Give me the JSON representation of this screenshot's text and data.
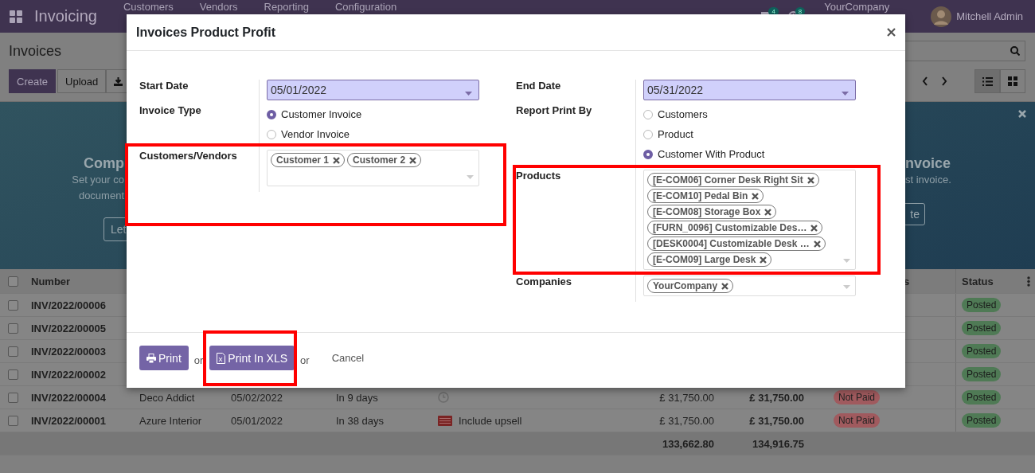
{
  "navbar": {
    "app_name": "Invoicing",
    "menu": [
      "Customers",
      "Vendors",
      "Reporting",
      "Configuration"
    ],
    "messages_count": "4",
    "activities_count": "8",
    "company": "YourCompany",
    "user": "Mitchell Admin"
  },
  "control_panel": {
    "title": "Invoices",
    "buttons": [
      "Create",
      "Upload"
    ],
    "views": [
      {
        "kind": "list",
        "selected": true
      },
      {
        "kind": "kanban",
        "selected": false
      }
    ]
  },
  "banner": {
    "left": {
      "title": "Comp",
      "lines": [
        "Set your co",
        "document"
      ],
      "button": "Let"
    },
    "right": {
      "title": "nvoice",
      "lines": [
        "st invoice."
      ],
      "button": "te"
    }
  },
  "table": {
    "header_checked": false,
    "columns": [
      "Number",
      "s",
      "Status"
    ],
    "rows": [
      {
        "checked": false,
        "number": "INV/2022/00006",
        "status": "Posted"
      },
      {
        "checked": false,
        "number": "INV/2022/00005",
        "status": "Posted"
      },
      {
        "checked": false,
        "number": "INV/2022/00003",
        "status": "Posted"
      },
      {
        "checked": false,
        "number": "INV/2022/00002",
        "status": "Posted"
      },
      {
        "checked": false,
        "number": "INV/2022/00004",
        "customer": "Deco Addict",
        "invoice_date": "05/02/2022",
        "due": "In 9 days",
        "activity": {
          "kind": "clock"
        },
        "untaxed": "£ 31,750.00",
        "total": "£ 31,750.00",
        "payment": "Not Paid",
        "status": "Posted"
      },
      {
        "checked": false,
        "number": "INV/2022/00001",
        "customer": "Azure Interior",
        "invoice_date": "05/01/2022",
        "due": "In 38 days",
        "activity": {
          "kind": "upsell",
          "summary": "Include upsell"
        },
        "untaxed": "£ 31,750.00",
        "total": "£ 31,750.00",
        "payment": "Not Paid",
        "status": "Posted"
      }
    ],
    "totals": [
      "133,662.80",
      "134,916.75"
    ]
  },
  "dialog": {
    "title": "Invoices Product Profit",
    "left": [
      {
        "kind": "date",
        "label": "Start Date",
        "value": "05/01/2022"
      },
      {
        "kind": "radio",
        "label": "Invoice Type",
        "options": [
          {
            "label": "Customer Invoice",
            "selected": true
          },
          {
            "label": "Vendor Invoice",
            "selected": false
          }
        ]
      },
      {
        "kind": "tags",
        "label": "Customers/Vendors",
        "tags": [
          "Customer 1",
          "Customer 2"
        ],
        "highlighted": true
      }
    ],
    "right": [
      {
        "kind": "date",
        "label": "End Date",
        "value": "05/31/2022"
      },
      {
        "kind": "radio",
        "label": "Report Print By",
        "options": [
          {
            "label": "Customers",
            "selected": false
          },
          {
            "label": "Product",
            "selected": false
          },
          {
            "label": "Customer With Product",
            "selected": true
          }
        ]
      },
      {
        "kind": "tags",
        "label": "Products",
        "tags": [
          "[E-COM06] Corner Desk Right Sit",
          "[E-COM10] Pedal Bin",
          "[E-COM08] Storage Box",
          "[FURN_0096] Customizable Des…",
          "[DESK0004] Customizable Desk …",
          "[E-COM09] Large Desk"
        ],
        "highlighted": true
      },
      {
        "kind": "tags",
        "label": "Companies",
        "tags": [
          "YourCompany"
        ]
      }
    ],
    "footer": [
      {
        "kind": "print_button",
        "label": "Print"
      },
      {
        "kind": "text",
        "text": "or"
      },
      {
        "kind": "xls_button",
        "label": "Print In XLS",
        "highlighted": true
      },
      {
        "kind": "text",
        "text": "or"
      },
      {
        "kind": "link",
        "label": "Cancel"
      }
    ]
  }
}
